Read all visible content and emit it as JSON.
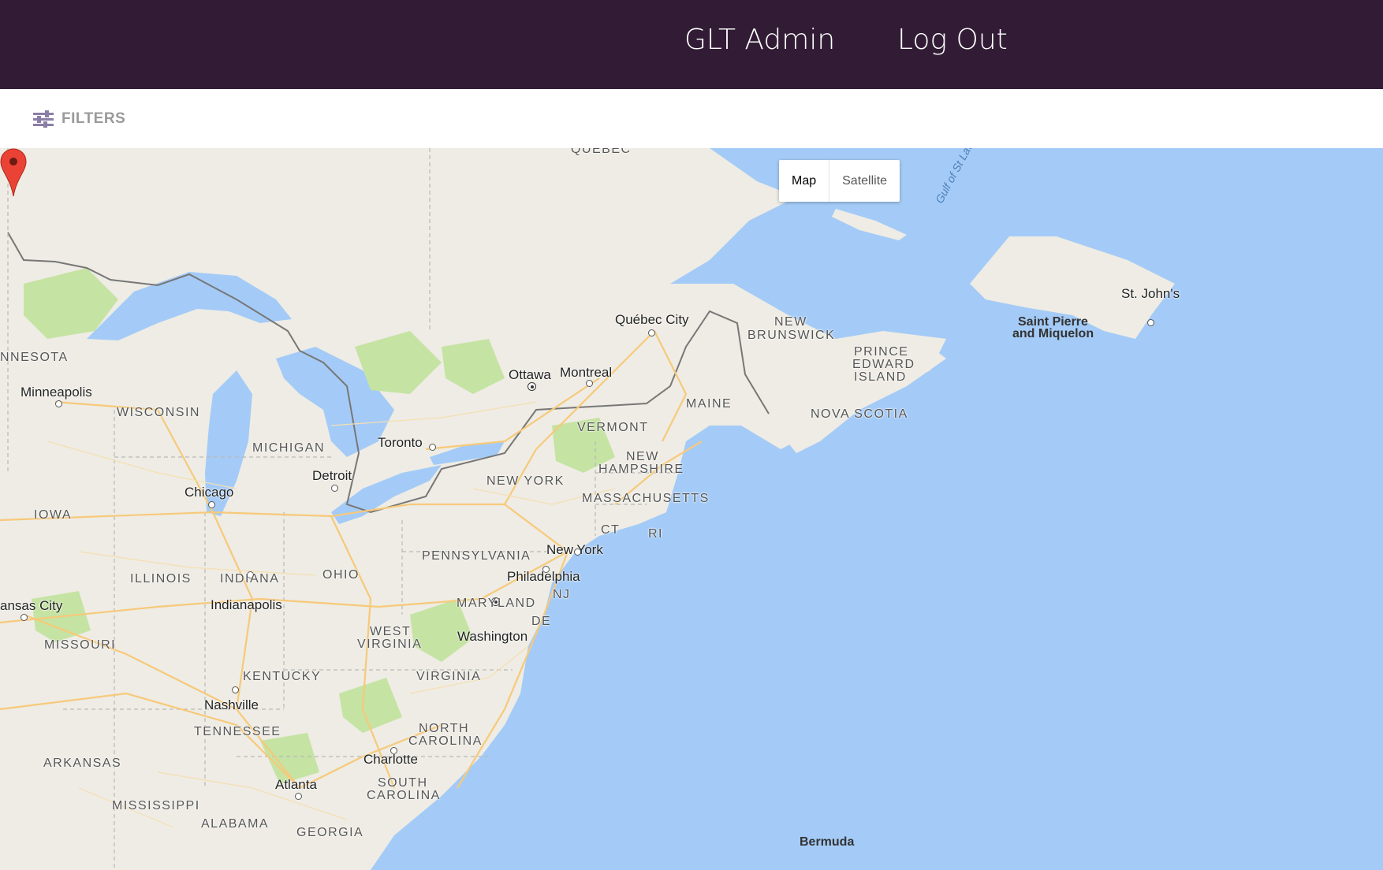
{
  "header": {
    "admin_label": "GLT Admin",
    "logout_label": "Log Out",
    "background": "#321c35"
  },
  "filters": {
    "label": "FILTERS",
    "icon": "sliders-icon"
  },
  "map": {
    "type_control": {
      "map_label": "Map",
      "satellite_label": "Satellite",
      "selected": "Map"
    },
    "marker": {
      "icon": "red-map-pin-icon",
      "color": "#ea4335",
      "location": "New York"
    },
    "cities": {
      "quebec_city": "Québec City",
      "ottawa": "Ottawa",
      "montreal": "Montreal",
      "minneapolis": "Minneapolis",
      "toronto": "Toronto",
      "detroit": "Detroit",
      "chicago": "Chicago",
      "new_york": "New York",
      "philadelphia": "Philadelphia",
      "washington": "Washington",
      "indianapolis": "Indianapolis",
      "kansas_city": "ansas City",
      "nashville": "Nashville",
      "charlotte": "Charlotte",
      "atlanta": "Atlanta",
      "st_johns": "St. John's",
      "bermuda": "Bermuda"
    },
    "regions": {
      "quebec": "QUEBEC",
      "new_brunswick_1": "NEW",
      "new_brunswick_2": "BRUNSWICK",
      "pei_1": "PRINCE",
      "pei_2": "EDWARD",
      "pei_3": "ISLAND",
      "nova_scotia": "NOVA SCOTIA",
      "saint_pierre_1": "Saint Pierre",
      "saint_pierre_2": "and Miquelon",
      "minnesota": "NNESOTA",
      "wisconsin": "WISCONSIN",
      "michigan": "MICHIGAN",
      "iowa": "IOWA",
      "illinois": "ILLINOIS",
      "indiana": "INDIANA",
      "ohio": "OHIO",
      "pennsylvania": "PENNSYLVANIA",
      "new_york_state": "NEW YORK",
      "vermont": "VERMONT",
      "new_hampshire_1": "NEW",
      "new_hampshire_2": "HAMPSHIRE",
      "maine": "MAINE",
      "massachusetts": "MASSACHUSETTS",
      "ct": "CT",
      "ri": "RI",
      "nj": "NJ",
      "de": "DE",
      "maryland": "MARYLAND",
      "missouri": "MISSOURI",
      "west_virginia_1": "WEST",
      "west_virginia_2": "VIRGINIA",
      "virginia": "VIRGINIA",
      "kentucky": "KENTUCKY",
      "tennessee": "TENNESSEE",
      "north_carolina_1": "NORTH",
      "north_carolina_2": "CAROLINA",
      "arkansas": "ARKANSAS",
      "south_carolina_1": "SOUTH",
      "south_carolina_2": "CAROLINA",
      "mississippi": "MISSISSIPPI",
      "alabama": "ALABAMA",
      "georgia": "GEORGIA"
    },
    "water": {
      "gulf_st_lawrence": "Gulf of St Lawrence"
    },
    "colors": {
      "water": "#a4cbf7",
      "land": "#eeece4",
      "park": "#c5e3a3",
      "road": "#f7c97a",
      "border": "#777777"
    }
  }
}
